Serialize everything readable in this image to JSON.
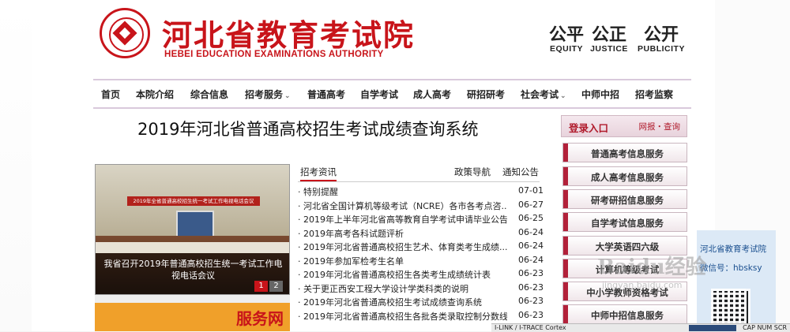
{
  "header": {
    "logo_cn": "河北省教育考试院",
    "logo_en": "HEBEI EDUCATION EXAMINATIONS AUTHORITY",
    "mottos": [
      {
        "cn": "公平",
        "en": "EQUITY"
      },
      {
        "cn": "公正",
        "en": "JUSTICE"
      },
      {
        "cn": "公开",
        "en": "PUBLICITY"
      }
    ]
  },
  "nav": [
    {
      "label": "首页",
      "dropdown": false
    },
    {
      "label": "本院介绍",
      "dropdown": false
    },
    {
      "label": "综合信息",
      "dropdown": false
    },
    {
      "label": "招考服务",
      "dropdown": true
    },
    {
      "label": "普通高考",
      "dropdown": false
    },
    {
      "label": "自学考试",
      "dropdown": false
    },
    {
      "label": "成人高考",
      "dropdown": false
    },
    {
      "label": "研招研考",
      "dropdown": false
    },
    {
      "label": "社会考试",
      "dropdown": true
    },
    {
      "label": "中师中招",
      "dropdown": false
    },
    {
      "label": "招考监察",
      "dropdown": false
    }
  ],
  "main_title": "2019年河北省普通高校招生考试成绩查询系统",
  "photo": {
    "banner": "2019年全省普通高校招生统一考试工作电视电话会议",
    "caption": "我省召开2019年普通高校招生统一考试工作电视电话会议",
    "pages": [
      "1",
      "2"
    ],
    "promo": "服务网"
  },
  "news_tabs": [
    "招考资讯",
    "政策导航",
    "通知公告"
  ],
  "news": [
    {
      "title": "· 特别提醒",
      "date": "07-01"
    },
    {
      "title": "· 河北省全国计算机等级考试（NCRE）各市各考点咨...",
      "date": "06-27"
    },
    {
      "title": "· 2019年上半年河北省高等教育自学考试申请毕业公告",
      "date": "06-25"
    },
    {
      "title": "· 2019年高考各科试题评析",
      "date": "06-24"
    },
    {
      "title": "· 2019年河北省普通高校招生艺术、体育类考生成绩...",
      "date": "06-24"
    },
    {
      "title": "· 2019年参加军检考生名单",
      "date": "06-24"
    },
    {
      "title": "· 2019年河北省普通高校招生各类考生成绩统计表",
      "date": "06-23"
    },
    {
      "title": "· 关于更正西安工程大学设计学类科类的说明",
      "date": "06-23"
    },
    {
      "title": "· 2019年河北省普通高校招生考试成绩查询系统",
      "date": "06-23"
    },
    {
      "title": "· 2019年河北省普通高校招生各批各类录取控制分数线",
      "date": "06-23"
    }
  ],
  "sidebar": {
    "login_title": "登录入口",
    "login_sub": "网报・查询",
    "buttons": [
      "普通高考信息服务",
      "成人高考信息服务",
      "研考研招信息服务",
      "自学考试信息服务",
      "大学英语四六级",
      "计算机等级考试",
      "中小学教师资格考试",
      "中师中招信息服务"
    ]
  },
  "float_box": {
    "line1": "河北省教育考试院",
    "line2": "微信号：hbsksy"
  },
  "watermark": {
    "big": "Baidu经验",
    "small": "jingyan.baidu.com"
  },
  "statusbar": {
    "left": "I-LINK / I-TRACE Cortex",
    "right": "CAP NUM SCR"
  },
  "colors": {
    "brand_red": "#c8141a",
    "nav_border": "#d9c9dc",
    "sidebar_accent": "#b2213a"
  }
}
